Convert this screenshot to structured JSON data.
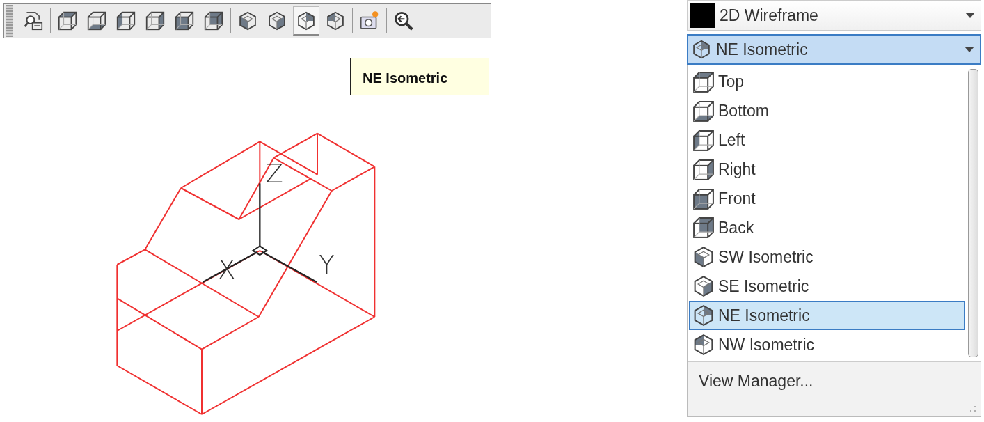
{
  "toolbar": {
    "groups": [
      [
        {
          "kind": "views",
          "selected": false
        }
      ],
      [
        {
          "kind": "top",
          "selected": false
        },
        {
          "kind": "bottom",
          "selected": false
        },
        {
          "kind": "left",
          "selected": false
        },
        {
          "kind": "right",
          "selected": false
        },
        {
          "kind": "front",
          "selected": false
        },
        {
          "kind": "back",
          "selected": false
        }
      ],
      [
        {
          "kind": "sw",
          "selected": false
        },
        {
          "kind": "se",
          "selected": false
        },
        {
          "kind": "ne",
          "selected": true
        },
        {
          "kind": "nw",
          "selected": false
        }
      ],
      [
        {
          "kind": "camera",
          "selected": false
        }
      ],
      [
        {
          "kind": "previous",
          "selected": false
        }
      ]
    ]
  },
  "tooltip": {
    "text": "NE Isometric"
  },
  "drawing": {
    "axis_labels": [
      "X",
      "Y",
      "Z"
    ]
  },
  "visual_style": {
    "label": "2D Wireframe"
  },
  "view_dropdown": {
    "value": "NE Isometric",
    "kind": "ne",
    "expanded": true,
    "items": [
      {
        "label": "Top",
        "kind": "top",
        "selected": false
      },
      {
        "label": "Bottom",
        "kind": "bottom",
        "selected": false
      },
      {
        "label": "Left",
        "kind": "left",
        "selected": false
      },
      {
        "label": "Right",
        "kind": "right",
        "selected": false
      },
      {
        "label": "Front",
        "kind": "front",
        "selected": false
      },
      {
        "label": "Back",
        "kind": "back",
        "selected": false
      },
      {
        "label": "SW Isometric",
        "kind": "sw",
        "selected": false
      },
      {
        "label": "SE Isometric",
        "kind": "se",
        "selected": false
      },
      {
        "label": "NE Isometric",
        "kind": "ne",
        "selected": true
      },
      {
        "label": "NW Isometric",
        "kind": "nw",
        "selected": false
      }
    ],
    "footer": "View Manager..."
  }
}
